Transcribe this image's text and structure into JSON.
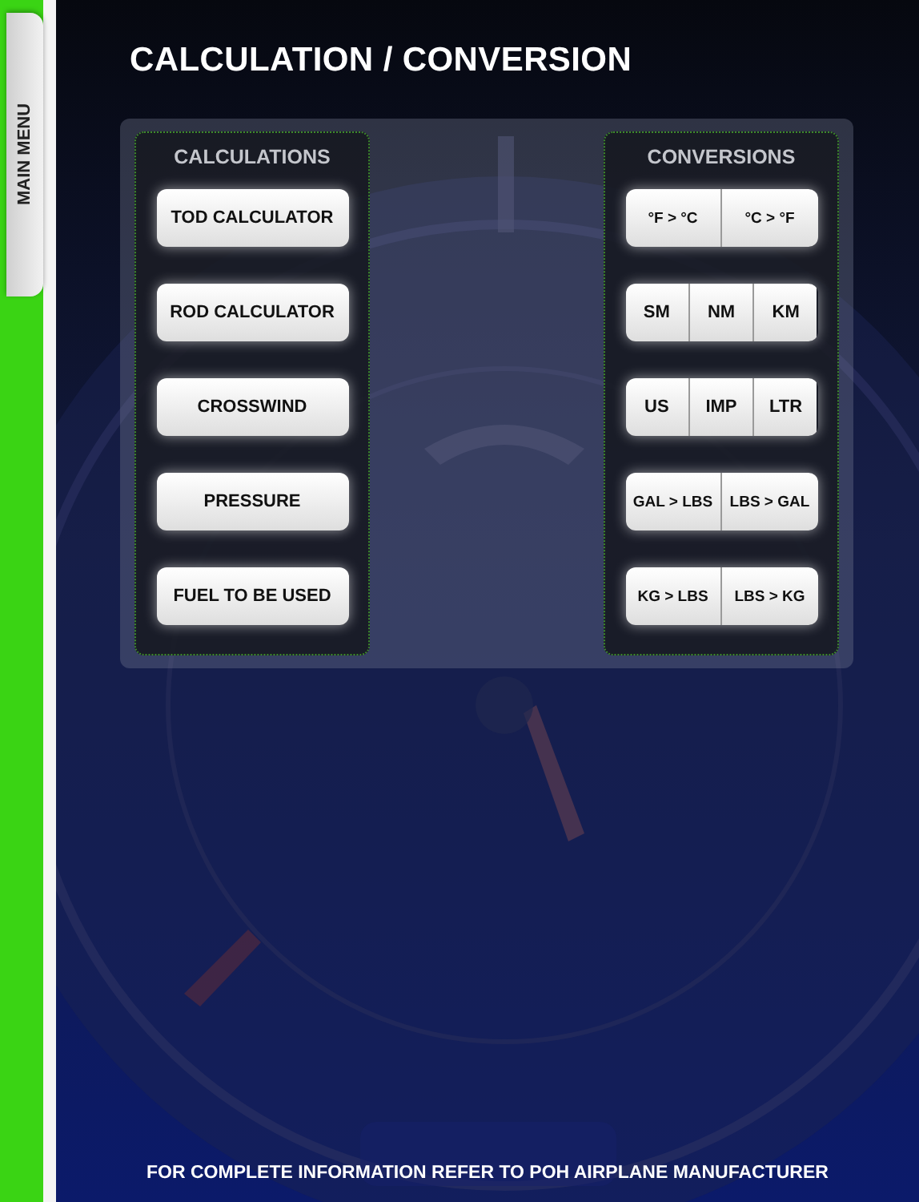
{
  "side_tab": {
    "label": "MAIN MENU"
  },
  "title": "CALCULATION / CONVERSION",
  "calculations": {
    "heading": "CALCULATIONS",
    "buttons": [
      "TOD CALCULATOR",
      "ROD CALCULATOR",
      "CROSSWIND",
      "PRESSURE",
      "FUEL TO BE USED"
    ]
  },
  "conversions": {
    "heading": "CONVERSIONS",
    "rows": [
      [
        "°F > °C",
        "°C > °F"
      ],
      [
        "SM",
        "NM",
        "KM"
      ],
      [
        "US",
        "IMP",
        "LTR"
      ],
      [
        "GAL > LBS",
        "LBS > GAL"
      ],
      [
        "KG > LBS",
        "LBS > KG"
      ]
    ]
  },
  "footer": "FOR COMPLETE INFORMATION REFER TO POH AIRPLANE MANUFACTURER"
}
